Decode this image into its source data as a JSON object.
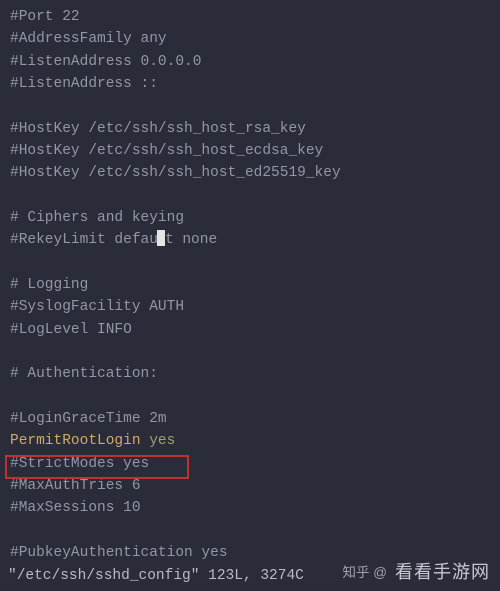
{
  "lines": [
    "#Port 22",
    "#AddressFamily any",
    "#ListenAddress 0.0.0.0",
    "#ListenAddress ::",
    "",
    "#HostKey /etc/ssh/ssh_host_rsa_key",
    "#HostKey /etc/ssh/ssh_host_ecdsa_key",
    "#HostKey /etc/ssh/ssh_host_ed25519_key",
    "",
    "# Ciphers and keying",
    "#RekeyLimit default none",
    "",
    "# Logging",
    "#SyslogFacility AUTH",
    "#LogLevel INFO",
    "",
    "# Authentication:",
    "",
    "#LoginGraceTime 2m",
    "__PERMIT_ROOT__",
    "#StrictModes yes",
    "#MaxAuthTries 6",
    "#MaxSessions 10",
    "",
    "#PubkeyAuthentication yes"
  ],
  "permit_root": {
    "directive": "PermitRootLogin",
    "value": "yes"
  },
  "cursor": {
    "line_index": 10,
    "after_text": "#RekeyLimit defau",
    "tail_text": "t none"
  },
  "status": {
    "file": "\"/etc/ssh/sshd_config\"",
    "meta": "123L, 3274C"
  },
  "watermark": {
    "prefix": "知乎 @",
    "site": "看看手游网"
  },
  "colors": {
    "background": "#2b2c3a",
    "comment": "#9097a8",
    "directive": "#d0a968",
    "value": "#9aa36b",
    "highlight_border": "#c23030"
  }
}
